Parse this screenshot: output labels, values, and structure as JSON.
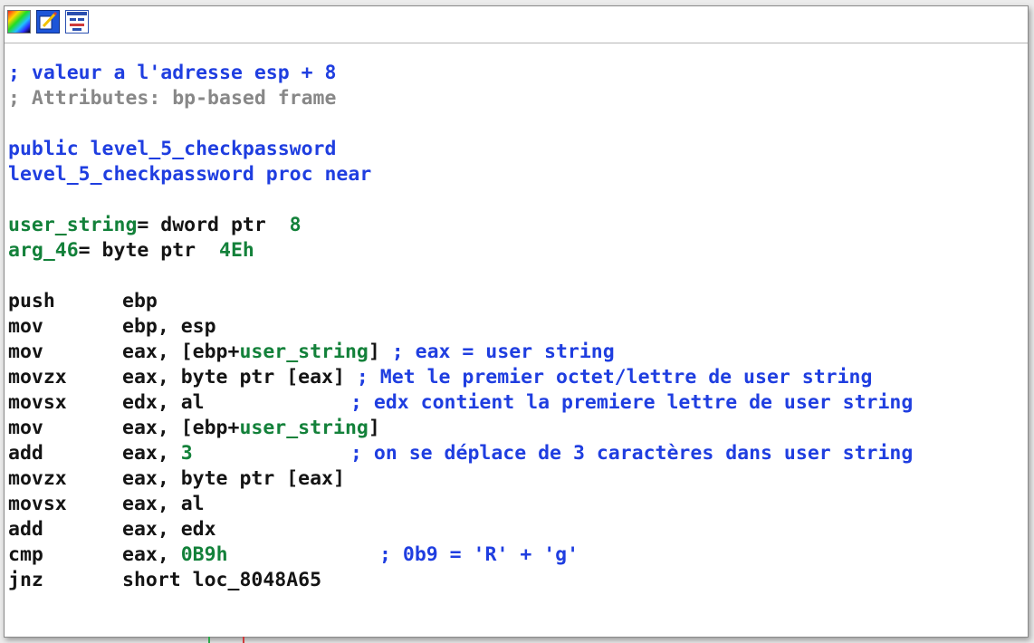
{
  "toolbar": {
    "buttons": [
      {
        "icon": "color-palette-icon"
      },
      {
        "icon": "edit-pencil-icon"
      },
      {
        "icon": "graph-view-icon"
      }
    ]
  },
  "code": {
    "comment1": "; valeur a l'adresse esp + 8",
    "attributes": "; Attributes: bp-based frame",
    "public_kw": "public ",
    "public_name": "level_5_checkpassword",
    "proc_line": "level_5_checkpassword proc near",
    "var1_name": "user_string",
    "var1_type": "= dword ptr  ",
    "var1_off": "8",
    "var2_name": "arg_46",
    "var2_type": "= byte ptr  ",
    "var2_off": "4Eh",
    "instructions": [
      {
        "mnemonic": "push",
        "operands": "ebp"
      },
      {
        "mnemonic": "mov",
        "operands": "ebp, esp"
      },
      {
        "mnemonic": "mov",
        "op_pre": "eax, [ebp+",
        "op_var": "user_string",
        "op_post": "]",
        "comment": "; eax = user string"
      },
      {
        "mnemonic": "movzx",
        "operands": "eax, byte ptr [eax]",
        "comment": "; Met le premier octet/lettre de user string"
      },
      {
        "mnemonic": "movsx",
        "operands": "edx, al",
        "comment": "; edx contient la premiere lettre de user string"
      },
      {
        "mnemonic": "mov",
        "op_pre": "eax, [ebp+",
        "op_var": "user_string",
        "op_post": "]"
      },
      {
        "mnemonic": "add",
        "op_pre": "eax, ",
        "op_num": "3",
        "comment": "; on se déplace de 3 caractères dans user string"
      },
      {
        "mnemonic": "movzx",
        "operands": "eax, byte ptr [eax]"
      },
      {
        "mnemonic": "movsx",
        "operands": "eax, al"
      },
      {
        "mnemonic": "add",
        "operands": "eax, edx"
      },
      {
        "mnemonic": "cmp",
        "op_pre": "eax, ",
        "op_num": "0B9h",
        "comment": "; 0b9 = 'R' + 'g'"
      },
      {
        "mnemonic": "jnz",
        "operands": "short loc_8048A65"
      }
    ]
  },
  "colors": {
    "comment": "#1f3ee0",
    "attribute": "#888888",
    "variable": "#13813a",
    "text": "#141414"
  }
}
